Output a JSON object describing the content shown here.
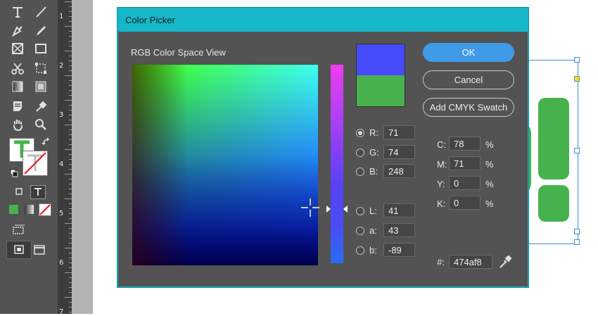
{
  "ruler": {
    "numbers": [
      "1",
      "2",
      "3",
      "4",
      "5",
      "6",
      "7"
    ]
  },
  "dialog": {
    "title": "Color Picker",
    "view_label": "RGB Color Space View",
    "buttons": {
      "ok": "OK",
      "cancel": "Cancel",
      "add_swatch": "Add CMYK Swatch"
    },
    "swatch": {
      "new_color": "#474af8",
      "original_color": "#47b24d"
    },
    "rgb": [
      {
        "key": "R:",
        "value": "71",
        "selected": true
      },
      {
        "key": "G:",
        "value": "74",
        "selected": false
      },
      {
        "key": "B:",
        "value": "248",
        "selected": false
      }
    ],
    "lab": [
      {
        "key": "L:",
        "value": "41"
      },
      {
        "key": "a:",
        "value": "43"
      },
      {
        "key": "b:",
        "value": "-89"
      }
    ],
    "cmyk": [
      {
        "key": "C:",
        "value": "78",
        "unit": "%"
      },
      {
        "key": "M:",
        "value": "71",
        "unit": "%"
      },
      {
        "key": "Y:",
        "value": "0",
        "unit": "%"
      },
      {
        "key": "K:",
        "value": "0",
        "unit": "%"
      }
    ],
    "hex": {
      "key": "#:",
      "value": "474af8"
    }
  },
  "colors": {
    "accent": "#15b8c9",
    "ok_button": "#3f9ae8",
    "artwork_green": "#47b24d",
    "tool_green": "#47b24d"
  },
  "icons": [
    "type-tool-icon",
    "line-tool-icon",
    "pen-tool-icon",
    "pencil-tool-icon",
    "rectangle-frame-icon",
    "rectangle-tool-icon",
    "scissors-icon",
    "free-transform-icon",
    "gradient-swatch-icon",
    "gradient-feather-icon",
    "note-tool-icon",
    "eyedropper-icon",
    "hand-tool-icon",
    "zoom-tool-icon",
    "swap-arrows-icon",
    "eyedropper-sample-icon"
  ]
}
